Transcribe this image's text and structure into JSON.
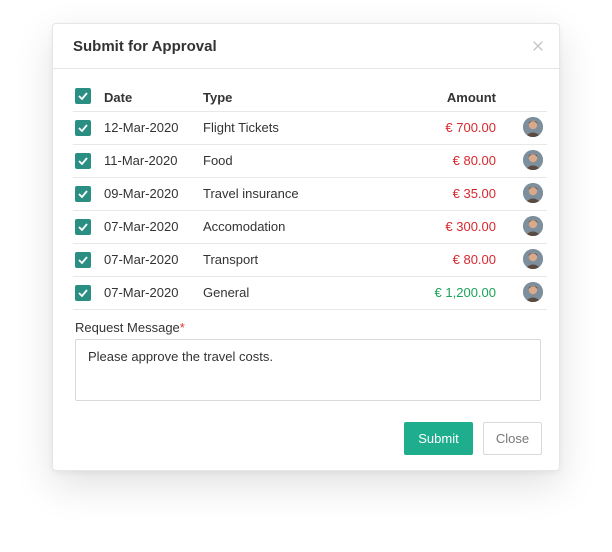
{
  "dialog": {
    "title": "Submit for Approval",
    "close_icon": "close-icon"
  },
  "table": {
    "headers": {
      "date": "Date",
      "type": "Type",
      "amount": "Amount"
    },
    "header_checked": true,
    "rows": [
      {
        "date": "12-Mar-2020",
        "type": "Flight Tickets",
        "amount": "€ 700.00",
        "amount_color": "#d9282f",
        "checked": true
      },
      {
        "date": "11-Mar-2020",
        "type": "Food",
        "amount": "€ 80.00",
        "amount_color": "#d9282f",
        "checked": true
      },
      {
        "date": "09-Mar-2020",
        "type": "Travel insurance",
        "amount": "€ 35.00",
        "amount_color": "#d9282f",
        "checked": true
      },
      {
        "date": "07-Mar-2020",
        "type": "Accomodation",
        "amount": "€ 300.00",
        "amount_color": "#d9282f",
        "checked": true
      },
      {
        "date": "07-Mar-2020",
        "type": "Transport",
        "amount": "€ 80.00",
        "amount_color": "#d9282f",
        "checked": true
      },
      {
        "date": "07-Mar-2020",
        "type": "General",
        "amount": "€ 1,200.00",
        "amount_color": "#1aa35a",
        "checked": true
      }
    ]
  },
  "message": {
    "label": "Request Message",
    "required_marker": "*",
    "value": "Please approve the travel costs."
  },
  "buttons": {
    "submit": "Submit",
    "close": "Close"
  },
  "colors": {
    "checkbox": "#2a8f82",
    "submit": "#1eae8e",
    "negative_amount": "#d9282f",
    "positive_amount": "#1aa35a"
  }
}
